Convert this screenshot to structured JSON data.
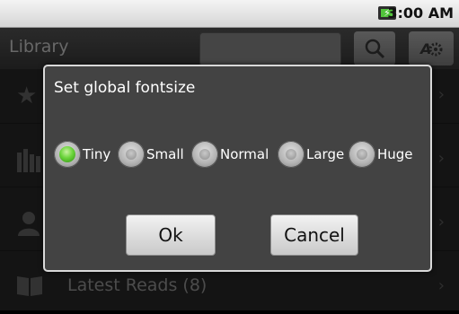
{
  "status_bar": {
    "time": "3:00 AM",
    "battery_icon": "battery-charging-icon"
  },
  "app": {
    "title": "Library",
    "search_icon": "search-icon",
    "settings_icon": "settings-icon",
    "rows": [
      {
        "icon": "star-icon",
        "label": ""
      },
      {
        "icon": "books-icon",
        "label": ""
      },
      {
        "icon": "person-icon",
        "label": ""
      },
      {
        "icon": "open-book-icon",
        "label": "Latest Reads (8)"
      }
    ]
  },
  "dialog": {
    "title": "Set global fontsize",
    "options": [
      "Tiny",
      "Small",
      "Normal",
      "Large",
      "Huge"
    ],
    "selected": "Tiny",
    "ok_label": "Ok",
    "cancel_label": "Cancel"
  },
  "colors": {
    "radio_selected": "#4fc42b",
    "dialog_bg": "#434343"
  }
}
